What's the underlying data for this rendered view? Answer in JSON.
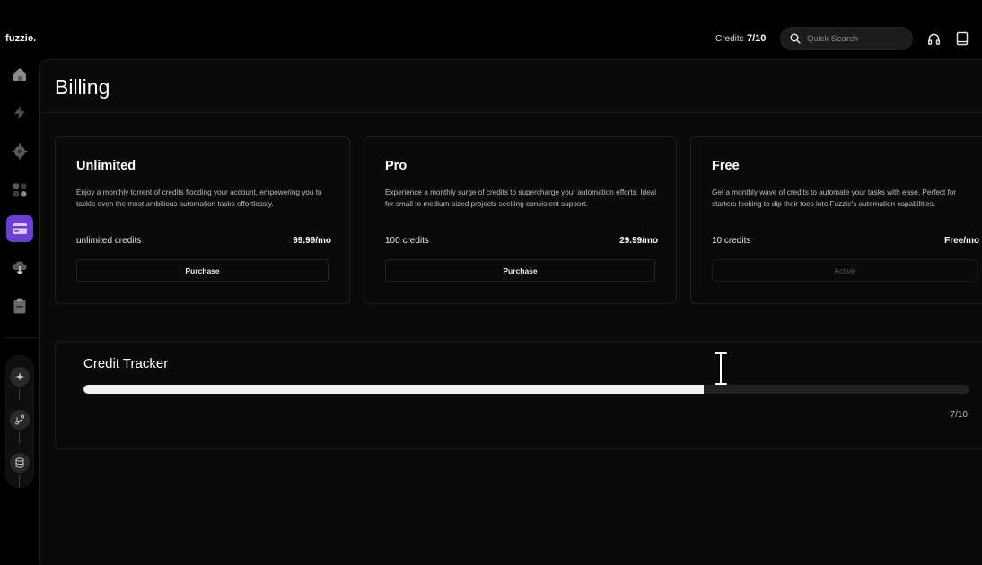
{
  "app": {
    "logo": "fuzzie."
  },
  "header": {
    "credits_label": "Credits",
    "credits_value": "7/10",
    "search_placeholder": "Quick Search"
  },
  "sidebar": {
    "items": [
      {
        "icon": "home-icon"
      },
      {
        "icon": "lightning-icon"
      },
      {
        "icon": "settings-icon"
      },
      {
        "icon": "apps-icon"
      },
      {
        "icon": "billing-icon",
        "active": true
      },
      {
        "icon": "cloud-download-icon"
      },
      {
        "icon": "clipboard-icon"
      }
    ],
    "tools": [
      {
        "icon": "sparkle-icon"
      },
      {
        "icon": "git-branch-icon"
      },
      {
        "icon": "database-icon"
      }
    ]
  },
  "page": {
    "title": "Billing"
  },
  "plans": [
    {
      "name": "Unlimited",
      "description": "Enjoy a monthly torrent of credits flooding your account, empowering you to tackle even the most ambitious automation tasks effortlessly.",
      "credits": "unlimited credits",
      "price": "99.99/mo",
      "button": "Purchase",
      "active": false
    },
    {
      "name": "Pro",
      "description": "Experience a monthly surge of credits to supercharge your automation efforts. Ideal for small to medium-sized projects seeking consistent support.",
      "credits": "100 credits",
      "price": "29.99/mo",
      "button": "Purchase",
      "active": false
    },
    {
      "name": "Free",
      "description": "Get a monthly wave of credits to automate your tasks with ease. Perfect for starters looking to dip their toes into Fuzzie's automation capabilities.",
      "credits": "10 credits",
      "price": "Free/mo",
      "button": "Active",
      "active": true
    }
  ],
  "tracker": {
    "title": "Credit Tracker",
    "used": 7,
    "total": 10,
    "count_label": "7/10"
  },
  "colors": {
    "accent": "#6b3fd1",
    "background": "#000000",
    "panel": "#0a0a0a",
    "progress_fill": "#f2f2f2",
    "progress_track": "#222222"
  }
}
